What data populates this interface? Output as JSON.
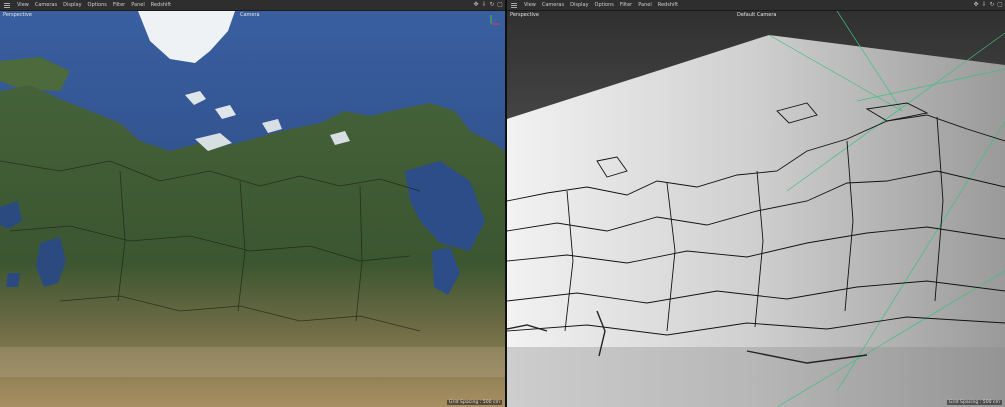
{
  "left_viewport": {
    "menu": [
      "View",
      "Cameras",
      "Display",
      "Options",
      "Filter",
      "Panel",
      "Redshift"
    ],
    "view_label": "Perspective",
    "camera_label": "Camera",
    "grid_spacing": "Grid Spacing : 500 cm",
    "toolbar_icons": [
      "move-icon",
      "camera-pan-icon",
      "rotate-icon",
      "maximize-icon"
    ]
  },
  "right_viewport": {
    "menu": [
      "View",
      "Cameras",
      "Display",
      "Options",
      "Filter",
      "Panel",
      "Redshift"
    ],
    "view_label": "Perspective",
    "camera_label": "Default Camera",
    "grid_spacing": "Grid Spacing : 500 cm",
    "toolbar_icons": [
      "move-icon",
      "camera-pan-icon",
      "rotate-icon",
      "maximize-icon"
    ]
  },
  "colors": {
    "ocean": "#2d4f8a",
    "land": "#3f5a2c",
    "desert": "#b79a6a",
    "ice": "#eef2f4",
    "grid_line": "#3fbf7f",
    "axis_x": "#e04040",
    "axis_y": "#40c040",
    "axis_z": "#4060e0"
  }
}
